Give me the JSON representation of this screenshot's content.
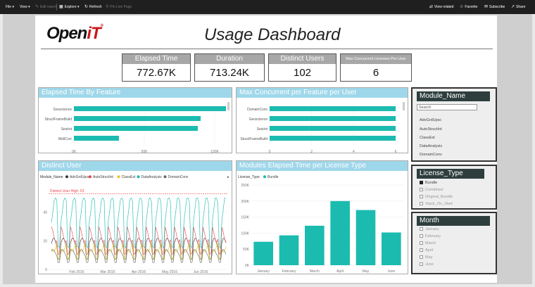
{
  "toolbar": {
    "file": "File",
    "view": "View",
    "edit_report": "Edit report",
    "explore": "Explore",
    "refresh": "Refresh",
    "pin_live_page": "Pin Live Page",
    "view_related": "View related",
    "favorite": "Favorite",
    "subscribe": "Subscribe",
    "share": "Share"
  },
  "header": {
    "logo_a": "Open",
    "logo_b": "iT",
    "logo_reg": "®",
    "title": "Usage Dashboard"
  },
  "kpis": [
    {
      "label": "Elapsed Time",
      "value": "772.67K"
    },
    {
      "label": "Duration",
      "value": "713.24K"
    },
    {
      "label": "Distinct Users",
      "value": "102"
    },
    {
      "label": "Max Concurrent Licenses Per User",
      "value": "6"
    }
  ],
  "panels": {
    "elapsed_by_feature": "Elapsed Time By Feature",
    "max_concurrent": "Max Concurrent per Feature per User",
    "distinct_user": "Distinct User",
    "modules_elapsed": "Modules Elapsed Time per License Type"
  },
  "chart_data": [
    {
      "type": "bar",
      "orientation": "horizontal",
      "title": "Elapsed Time By Feature",
      "categories": [
        "Geoscience",
        "StructFrameBuild",
        "SeisInt",
        "WellCorr"
      ],
      "values": [
        108000,
        90000,
        88000,
        32000
      ],
      "xlim": [
        0,
        110000
      ],
      "ticks": [
        "0K",
        "50K",
        "100K"
      ],
      "tick_values": [
        0,
        50000,
        100000
      ],
      "color": "#1bbbb0"
    },
    {
      "type": "bar",
      "orientation": "horizontal",
      "title": "Max Concurrent per Feature per User",
      "categories": [
        "DomainConv",
        "Geoscience",
        "SeisInt",
        "StructFrameBuild"
      ],
      "values": [
        6,
        6,
        6,
        6
      ],
      "xlim": [
        0,
        6.2
      ],
      "ticks": [
        "0",
        "2",
        "4",
        "6"
      ],
      "tick_values": [
        0,
        2,
        4,
        6
      ],
      "color": "#1bbbb0"
    },
    {
      "type": "line",
      "title": "Distinct User",
      "legend_title": "Module_Name",
      "series": [
        {
          "name": "AdvGrdUpsc",
          "color": "#333333"
        },
        {
          "name": "AutoStructInt",
          "color": "#e8464e"
        },
        {
          "name": "ClassEst",
          "color": "#f0c419"
        },
        {
          "name": "DataAnalysis",
          "color": "#1bbbb0"
        },
        {
          "name": "DomainConv",
          "color": "#5f6b6d"
        }
      ],
      "ticks_y": [
        "0",
        "20",
        "40"
      ],
      "tick_values_y": [
        0,
        20,
        40
      ],
      "ylim": [
        0,
        58
      ],
      "ticks_x": [
        "Feb 2016",
        "Mar 2016",
        "Apr 2016",
        "May 2016",
        "Jun 2016"
      ],
      "reference_line": {
        "label": "Distinct User High: 53",
        "value": 53,
        "color": "#e8464e"
      }
    },
    {
      "type": "bar",
      "title": "Modules Elapsed Time per License Type",
      "legend_title": "License_Type",
      "series": [
        {
          "name": "Bundle",
          "values": [
            73000,
            93000,
            123000,
            200000,
            172000,
            102000
          ]
        }
      ],
      "categories": [
        "January",
        "February",
        "March",
        "April",
        "May",
        "June"
      ],
      "ylim": [
        0,
        250000
      ],
      "ticks_y": [
        "0K",
        "50K",
        "100K",
        "150K",
        "200K",
        "250K"
      ],
      "tick_values_y": [
        0,
        50000,
        100000,
        150000,
        200000,
        250000
      ],
      "color": "#1bbbb0"
    }
  ],
  "slicers": {
    "module": {
      "title": "Module_Name",
      "search_placeholder": "Search",
      "items": [
        "AdvGrdUpsc",
        "AutoStructInt",
        "ClassEst",
        "DataAnalysis",
        "DomainConv"
      ]
    },
    "license": {
      "title": "License_Type",
      "items": [
        {
          "label": "Bundle",
          "checked": true
        },
        {
          "label": "Combined",
          "checked": false
        },
        {
          "label": "Original_Bundle",
          "checked": false
        },
        {
          "label": "Stack_On_Start",
          "checked": false
        }
      ]
    },
    "month": {
      "title": "Month",
      "items": [
        "January",
        "February",
        "March",
        "April",
        "May",
        "June"
      ]
    }
  }
}
